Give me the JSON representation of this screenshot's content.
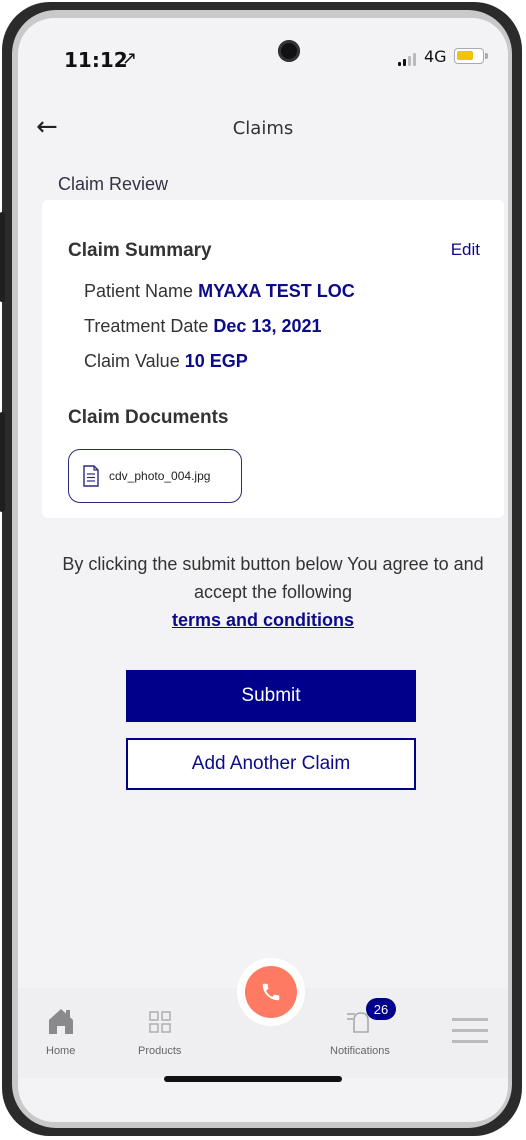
{
  "status_bar": {
    "time": "11:12",
    "location_glyph": "↗",
    "network": "4G",
    "battery_color": "#f2c400"
  },
  "header": {
    "back_glyph": "←",
    "title": "Claims"
  },
  "section_title": "Claim Review",
  "summary": {
    "heading": "Claim Summary",
    "edit_label": "Edit",
    "patient_label": "Patient Name",
    "patient_value": "MYAXA TEST LOC",
    "treatment_label": "Treatment Date",
    "treatment_value": "Dec 13, 2021",
    "claim_value_label": "Claim Value",
    "claim_value_value": "10 EGP"
  },
  "documents": {
    "heading": "Claim Documents",
    "files": [
      {
        "name": "cdv_photo_004.jpg"
      }
    ]
  },
  "agreement": {
    "text": "By clicking the submit button below You agree to and accept the following",
    "link": "terms and conditions"
  },
  "buttons": {
    "submit": "Submit",
    "add_another": "Add Another Claim"
  },
  "nav": {
    "home": "Home",
    "products": "Products",
    "notifications": "Notifications",
    "notifications_count": "26"
  },
  "colors": {
    "brand": "#00008a",
    "fab": "#ff7a63"
  }
}
